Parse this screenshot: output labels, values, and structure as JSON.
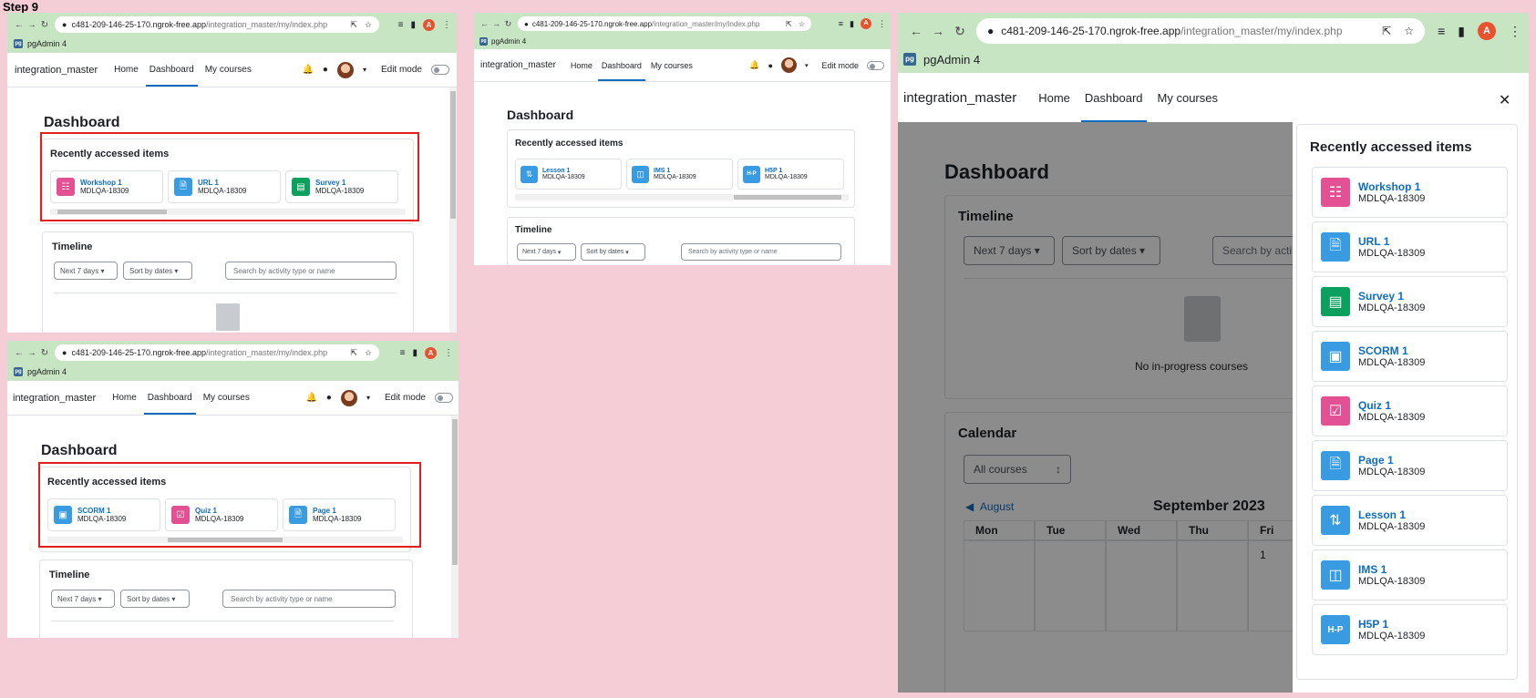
{
  "step_label": "Step 9",
  "browser": {
    "url_host": "c481-209-146-25-170.ngrok-free.app",
    "url_path": "/integration_master/my/index.php",
    "bookmark_label": "pgAdmin 4",
    "bookmark_icon_text": "pg",
    "profile_initial": "A"
  },
  "moodle": {
    "site_name": "integration_master",
    "nav_home": "Home",
    "nav_dashboard": "Dashboard",
    "nav_my_courses": "My courses",
    "edit_mode": "Edit mode",
    "page_title": "Dashboard",
    "recent_title": "Recently accessed items",
    "timeline_title": "Timeline",
    "filter_days": "Next 7 days",
    "filter_sort": "Sort by dates",
    "search_placeholder": "Search by activity type or name",
    "search_short": "Search by acti",
    "no_courses": "No in-progress courses",
    "calendar_title": "Calendar",
    "calendar_filter": "All courses",
    "prev_month": "August",
    "current_month": "September 2023",
    "weekdays": [
      "Mon",
      "Tue",
      "Wed",
      "Thu",
      "Fri"
    ],
    "first_day": "1",
    "course_code": "MDLQA-18309"
  },
  "items": {
    "workshop": "Workshop 1",
    "url": "URL 1",
    "survey": "Survey 1",
    "scorm": "SCORM 1",
    "quiz": "Quiz 1",
    "page": "Page 1",
    "lesson": "Lesson 1",
    "ims": "IMS 1",
    "h5p": "H5P 1"
  },
  "icons": {
    "h5p_text": "H-P"
  }
}
